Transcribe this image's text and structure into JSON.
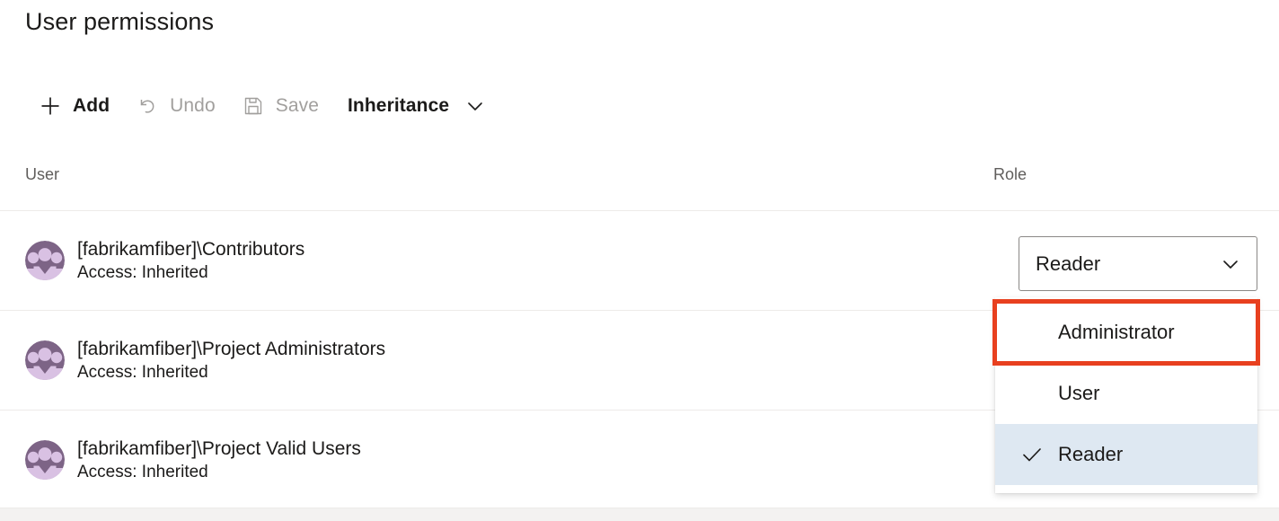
{
  "page": {
    "title": "User permissions"
  },
  "command_bar": {
    "buttons": [
      {
        "label": "Add",
        "icon": "plus-icon",
        "disabled": false
      },
      {
        "label": "Undo",
        "icon": "undo-icon",
        "disabled": true
      },
      {
        "label": "Save",
        "icon": "save-icon",
        "disabled": true
      },
      {
        "label": "Inheritance",
        "icon": "chevron-down-icon",
        "disabled": false
      }
    ]
  },
  "table": {
    "columns": {
      "user": "User",
      "role": "Role"
    },
    "rows": [
      {
        "avatar": "group-avatar-icon",
        "name": "[fabrikamfiber]\\Contributors",
        "access": "Access: Inherited"
      },
      {
        "avatar": "group-avatar-icon",
        "name": "[fabrikamfiber]\\Project Administrators",
        "access": "Access: Inherited"
      },
      {
        "avatar": "group-avatar-icon",
        "name": "[fabrikamfiber]\\Project Valid Users",
        "access": "Access: Inherited"
      }
    ]
  },
  "role_combobox": {
    "value": "Reader",
    "chevron": "chevron-down-icon",
    "expanded": true
  },
  "role_dropdown": {
    "options": [
      {
        "label": "Administrator",
        "selected": false,
        "annotated": true
      },
      {
        "label": "User",
        "selected": false,
        "annotated": false
      },
      {
        "label": "Reader",
        "selected": true,
        "annotated": false
      }
    ],
    "check_icon": "checkmark-icon"
  },
  "colors": {
    "annotation_highlight": "#e8401f",
    "selected_row_background": "#dee8f2",
    "avatar_background": "#7d6486",
    "avatar_foreground": "#d9c1e3",
    "divider": "#edebe9",
    "text_primary": "#1b1a19",
    "text_secondary": "#605e5c",
    "text_disabled": "#a19f9d"
  }
}
